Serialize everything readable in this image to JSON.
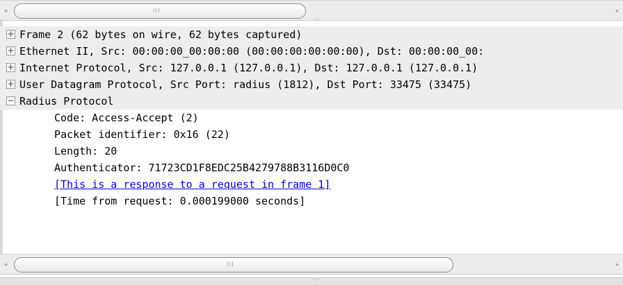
{
  "tree": {
    "rows": [
      {
        "expander": "+",
        "text": "Frame 2 (62 bytes on wire, 62 bytes captured)"
      },
      {
        "expander": "+",
        "text": "Ethernet II, Src: 00:00:00_00:00:00 (00:00:00:00:00:00), Dst: 00:00:00_00:"
      },
      {
        "expander": "+",
        "text": "Internet Protocol, Src: 127.0.0.1 (127.0.0.1), Dst: 127.0.0.1 (127.0.0.1)"
      },
      {
        "expander": "+",
        "text": "User Datagram Protocol, Src Port: radius (1812), Dst Port: 33475 (33475)"
      },
      {
        "expander": "−",
        "text": "Radius Protocol"
      }
    ],
    "children": [
      {
        "text": "Code: Access-Accept (2)"
      },
      {
        "text": "Packet identifier: 0x16 (22)"
      },
      {
        "text": "Length: 20"
      },
      {
        "text": "Authenticator: 71723CD1F8EDC25B4279788B3116D0C0"
      },
      {
        "text": "[This is a response to a request in frame 1]"
      },
      {
        "text": "[Time from request: 0.000199000 seconds]"
      }
    ]
  },
  "scrollbar": {
    "left_arrow": "◂",
    "right_arrow": "▸",
    "grip": "III"
  }
}
